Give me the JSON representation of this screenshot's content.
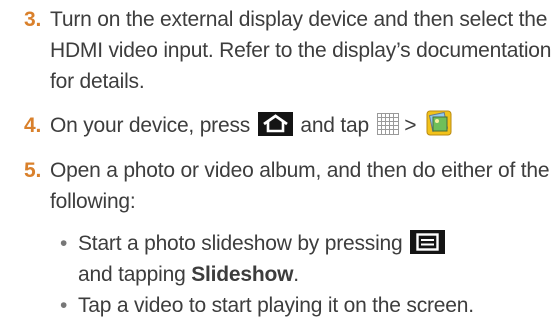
{
  "steps": [
    {
      "number": "3.",
      "text": "Turn on the external display device and then select the HDMI video input. Refer to the display’s documentation for details."
    },
    {
      "number": "4.",
      "text_before_home": "On your device, press",
      "text_mid": "and tap",
      "separator": ">",
      "icons": [
        "home-key-icon",
        "apps-grid-icon",
        "gallery-icon"
      ]
    },
    {
      "number": "5.",
      "text": "Open a photo or video album, and then do either of the following:"
    }
  ],
  "bullets": [
    {
      "dot": "•",
      "text_before": "Start a photo slideshow by pressing",
      "text_after": "and tapping",
      "strong": "Slideshow",
      "end": ".",
      "icon": "menu-key-icon"
    },
    {
      "dot": "•",
      "text": "Tap a video to start playing it on the screen."
    }
  ],
  "colors": {
    "step_number": "#d9802b",
    "body_text": "#3d3d3d",
    "key_background": "#141414"
  }
}
